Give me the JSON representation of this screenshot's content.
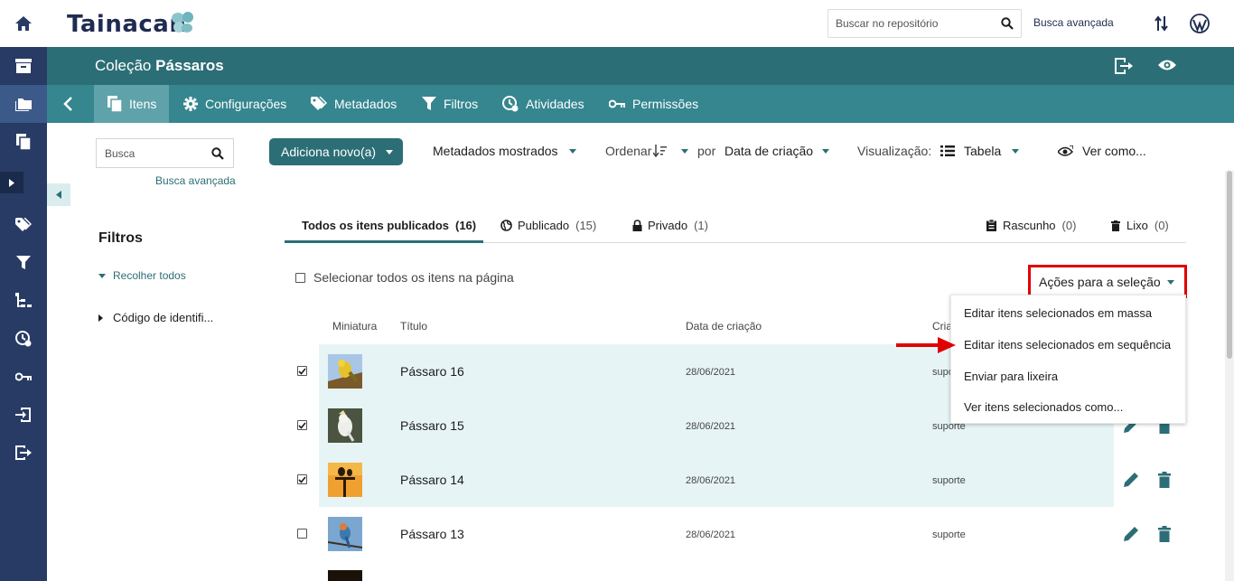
{
  "app": {
    "logo_text": "Tainacan"
  },
  "topbar": {
    "search_placeholder": "Buscar no repositório",
    "advanced_search": "Busca avançada"
  },
  "collection": {
    "prefix": "Coleção",
    "name": "Pássaros"
  },
  "nav": {
    "tabs": [
      {
        "label": "Itens",
        "icon": "items-icon",
        "active": true
      },
      {
        "label": "Configurações",
        "icon": "gear-icon"
      },
      {
        "label": "Metadados",
        "icon": "tags-icon"
      },
      {
        "label": "Filtros",
        "icon": "filter-icon"
      },
      {
        "label": "Atividades",
        "icon": "activities-icon"
      },
      {
        "label": "Permissões",
        "icon": "key-icon"
      }
    ]
  },
  "filters": {
    "search_placeholder": "Busca",
    "advanced_search": "Busca avançada",
    "title": "Filtros",
    "collapse_all": "Recolher todos",
    "items": [
      "Código de identifi..."
    ]
  },
  "toolbar": {
    "add_new": "Adiciona novo(a)",
    "metadata_shown": "Metadados mostrados",
    "sort_label": "Ordenar",
    "by_label": "por",
    "sort_field": "Data de criação",
    "view_label": "Visualização:",
    "view_mode": "Tabela",
    "view_as": "Ver como..."
  },
  "status_tabs": [
    {
      "label": "Todos os itens publicados",
      "count": "(16)",
      "active": true
    },
    {
      "label": "Publicado",
      "count": "(15)",
      "icon": "globe-icon"
    },
    {
      "label": "Privado",
      "count": "(1)",
      "icon": "lock-icon"
    },
    {
      "label": "Rascunho",
      "count": "(0)",
      "icon": "clipboard-icon"
    },
    {
      "label": "Lixo",
      "count": "(0)",
      "icon": "trash-icon"
    }
  ],
  "selection": {
    "select_all": "Selecionar todos os itens na página",
    "actions_button": "Ações para a seleção",
    "actions_menu": [
      "Editar itens selecionados em massa",
      "Editar itens selecionados em sequência",
      "Enviar para lixeira",
      "Ver itens selecionados como..."
    ]
  },
  "table": {
    "columns": [
      "Miniatura",
      "Título",
      "Data de criação",
      "Cria"
    ],
    "rows": [
      {
        "title": "Pássaro 16",
        "date": "28/06/2021",
        "author": "suporte",
        "checked": true
      },
      {
        "title": "Pássaro 15",
        "date": "28/06/2021",
        "author": "suporte",
        "checked": true
      },
      {
        "title": "Pássaro 14",
        "date": "28/06/2021",
        "author": "suporte",
        "checked": true
      },
      {
        "title": "Pássaro 13",
        "date": "28/06/2021",
        "author": "suporte",
        "checked": false
      }
    ]
  },
  "colors": {
    "rail": "#273b64",
    "collection_header": "#2c6e76",
    "nav_tabs": "#35868f",
    "accent": "#2c6e76",
    "selected_row": "#e6f4f5",
    "highlight": "#e00000"
  }
}
